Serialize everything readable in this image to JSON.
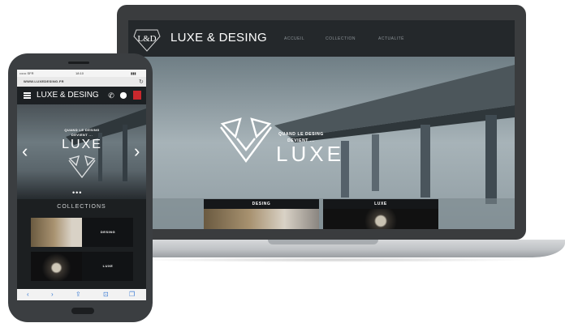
{
  "laptop": {
    "logo_text": "L&D",
    "brand": "LUXE & DESING",
    "menu": [
      "ACCUEIL",
      "COLLECTION",
      "ACTUALITÉ"
    ],
    "hero": {
      "tagline_line1": "QUAND LE DESING",
      "tagline_line2": "DEVIENT ...",
      "headline": "LUXE"
    },
    "cards": [
      {
        "label": "DESING"
      },
      {
        "label": "LUXE"
      }
    ]
  },
  "phone": {
    "status": {
      "carrier": "•••••• SFR",
      "time": "18:10",
      "battery": "▮▮▮"
    },
    "url": "WWW.LUXEDESING.FR",
    "brand": "LUXE & DESING",
    "hero": {
      "tagline_line1": "QUAND LE DESING",
      "tagline_line2": "DEVIENT ...",
      "headline": "LUXE",
      "prev": "‹",
      "next": "›",
      "dots": "•••"
    },
    "collections_title": "COLLECTIONS",
    "cards": [
      {
        "label": "DESING"
      },
      {
        "label": "LUXE"
      }
    ],
    "toolbar": [
      "‹",
      "›",
      "⇪",
      "⊡",
      "❐"
    ]
  },
  "colors": {
    "nav_bg": "#24282b",
    "accent_red": "#c8282d",
    "card_bg": "#151719"
  }
}
